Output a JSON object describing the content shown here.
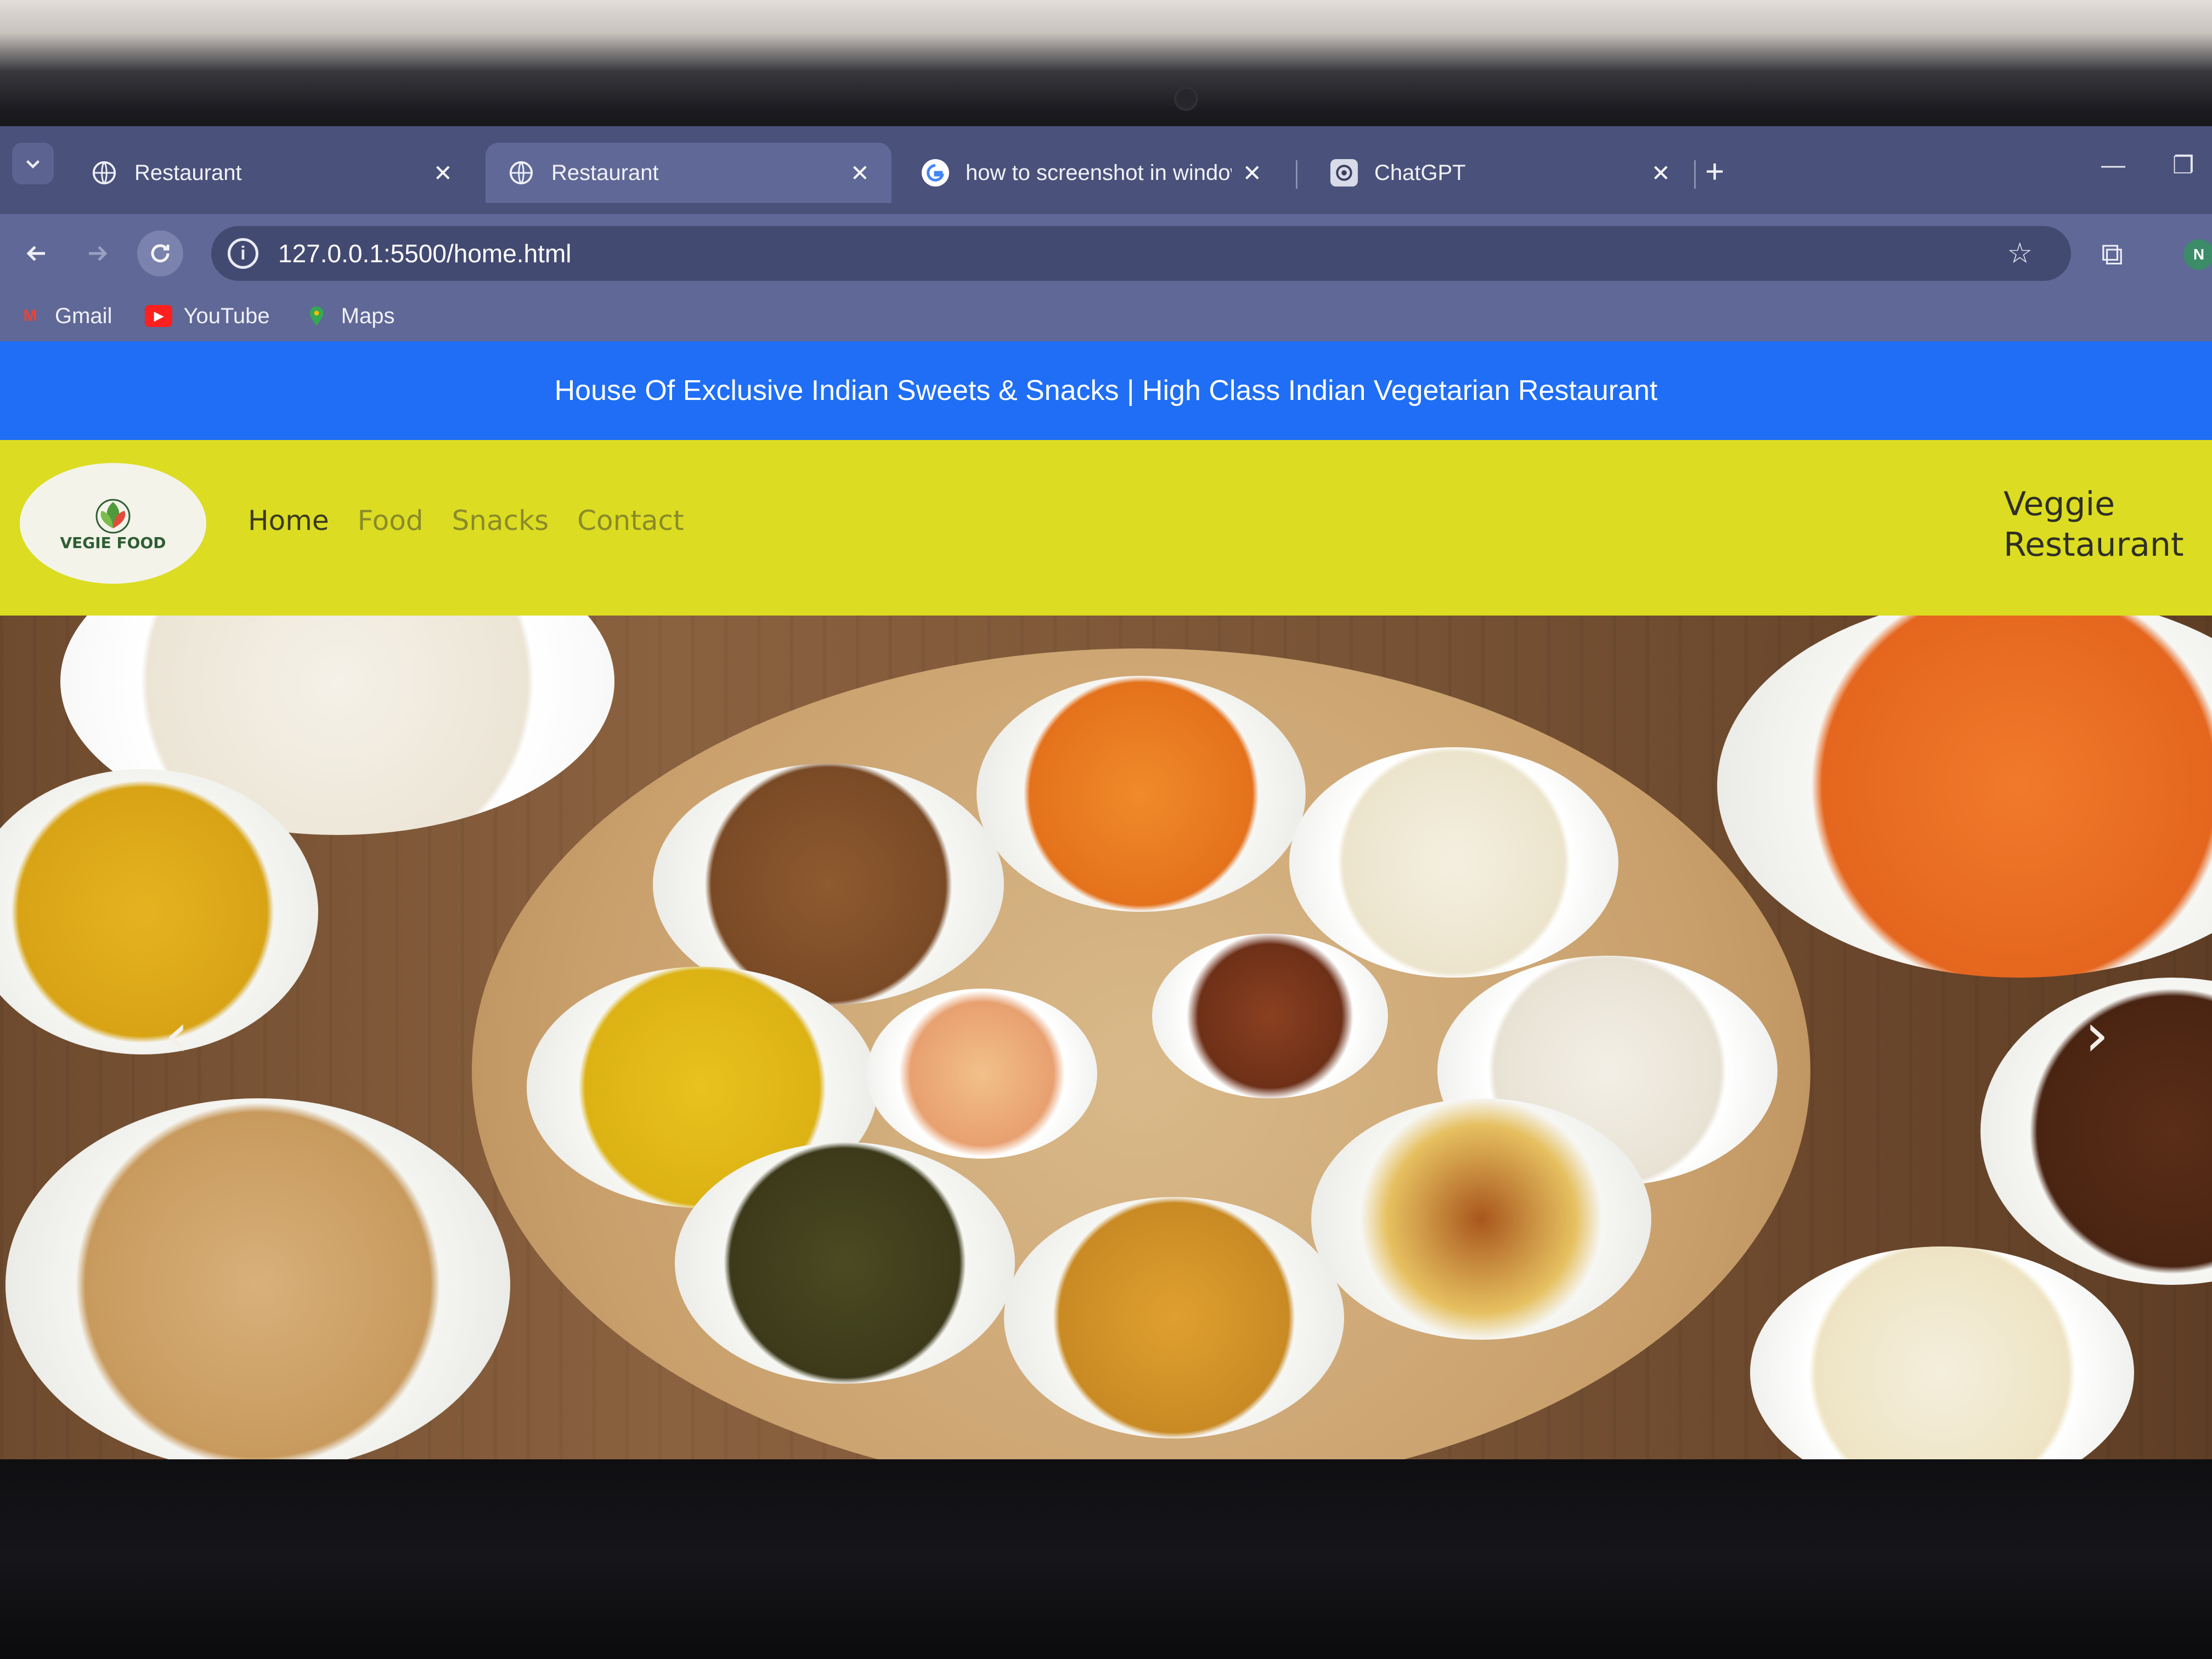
{
  "browser": {
    "tabs": [
      {
        "title": "Restaurant",
        "icon": "globe-icon",
        "active": false
      },
      {
        "title": "Restaurant",
        "icon": "globe-icon",
        "active": true
      },
      {
        "title": "how to screenshot in windows",
        "icon": "google-icon",
        "active": false
      },
      {
        "title": "ChatGPT",
        "icon": "chatgpt-icon",
        "active": false
      }
    ],
    "close_glyph": "✕",
    "new_tab_glyph": "+",
    "address": "127.0.0.1:5500/home.html",
    "bookmarks": [
      {
        "label": "Gmail",
        "icon": "gmail-icon"
      },
      {
        "label": "YouTube",
        "icon": "youtube-icon"
      },
      {
        "label": "Maps",
        "icon": "maps-icon"
      }
    ],
    "profile_initial": "N"
  },
  "site": {
    "announcement": "House Of Exclusive Indian Sweets & Snacks | High Class Indian Vegetarian Restaurant",
    "logo_text": "VEGIE FOOD",
    "nav": [
      "Home",
      "Food",
      "Snacks",
      "Contact"
    ],
    "active_nav": "Home",
    "brand_line1": "Veggie",
    "brand_line2": "Restaurant",
    "hero_prev": "‹",
    "hero_next": "›"
  },
  "colors": {
    "announcement_bg": "#1f6ef5",
    "navbar_bg": "#dcdc22",
    "browser_chrome": "#5f6896"
  }
}
